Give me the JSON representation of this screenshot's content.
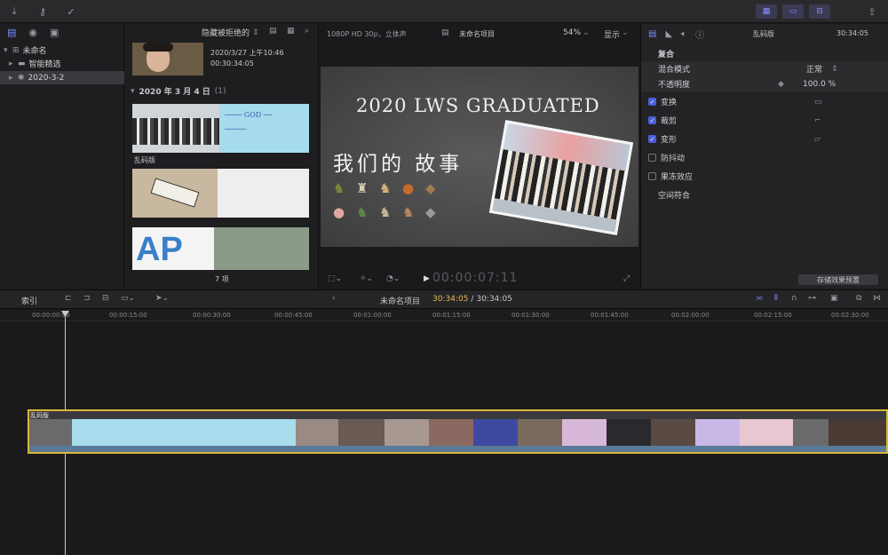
{
  "toolbar": {
    "download_icon": "download-icon",
    "key_icon": "key-icon",
    "check_icon": "check-icon",
    "share_icon": "share-icon"
  },
  "libraries": {
    "items": [
      {
        "label": "未命名",
        "icon": "library-icon"
      },
      {
        "label": "智能精选",
        "icon": "folder-icon"
      },
      {
        "label": "2020-3-2",
        "icon": "event-icon"
      }
    ]
  },
  "browser": {
    "filter_label": "隐藏被拒绝的",
    "top_clip": {
      "date": "2020/3/27 上午10:46",
      "duration": "00:30:34:05"
    },
    "group_header": "2020 年 3 月 4 日",
    "group_count": "(1)",
    "clip_label": "乱码版",
    "item_count": "7 项"
  },
  "viewer": {
    "format": "1080P HD 30p，立体声",
    "project_name": "未命名项目",
    "zoom": "54%",
    "display_menu": "显示",
    "timecode": "00:00:07:11",
    "title_text": "2020 LWS GRADUATED",
    "subtitle_text": "我们的 故事"
  },
  "inspector": {
    "clip_name": "乱码版",
    "duration": "30:34:05",
    "section_composite": "复合",
    "blend_mode_label": "混合模式",
    "blend_mode_value": "正常",
    "opacity_label": "不透明度",
    "opacity_value": "100.0 %",
    "rows": [
      {
        "label": "变换",
        "checked": true
      },
      {
        "label": "裁剪",
        "checked": true
      },
      {
        "label": "变形",
        "checked": true
      },
      {
        "label": "防抖动",
        "checked": false
      },
      {
        "label": "果冻效应",
        "checked": false
      }
    ],
    "spatial_label": "空间符合",
    "save_preset_label": "存储效果预置"
  },
  "timeline": {
    "index_label": "索引",
    "project_name": "未命名项目",
    "current_time": "30:34:05",
    "total_time": "30:34:05",
    "ruler_labels": [
      "00:00:00:00",
      "00:00:15:00",
      "00:00:30:00",
      "00:00:45:00",
      "00:01:00:00",
      "00:01:15:00",
      "00:01:30:00",
      "00:01:45:00",
      "00:02:00:00",
      "00:02:15:00",
      "00:02:30:00"
    ],
    "clip_name": "乱码版"
  },
  "colors": {
    "accent": "#4a5fd8",
    "clip_border": "#d9b83a",
    "timecode_active": "#e6b84a"
  }
}
